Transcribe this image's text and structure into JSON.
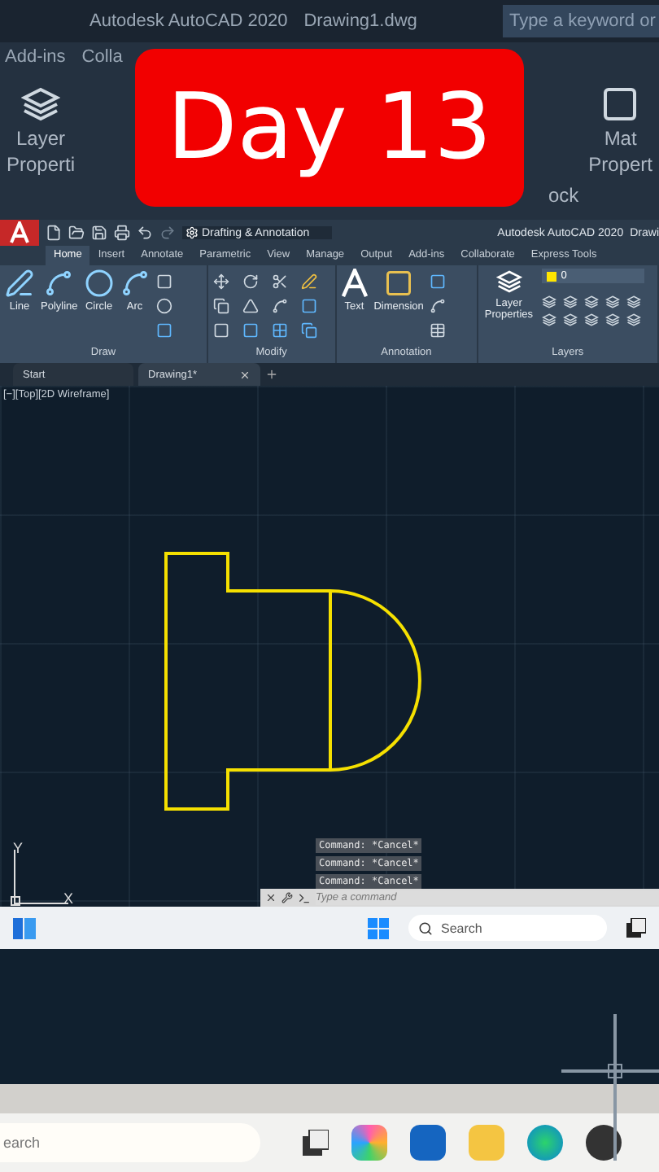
{
  "background_window": {
    "title": "Autodesk AutoCAD 2020",
    "file": "Drawing1.dwg",
    "search": {
      "placeholder": "Type a keyword or"
    },
    "menu": [
      "Add-ins",
      "Colla"
    ],
    "left_labels": [
      "Layer",
      "Properti"
    ],
    "right_labels": [
      "Mat",
      "Propert"
    ],
    "group_label": "ock"
  },
  "overlay_badge": "Day 13",
  "quick_access": {
    "workspace": "Drafting & Annotation",
    "title": "Autodesk AutoCAD 2020",
    "file": "Drawi"
  },
  "ribbon_tabs": [
    {
      "label": "Home",
      "selected": true
    },
    {
      "label": "Insert",
      "selected": false
    },
    {
      "label": "Annotate",
      "selected": false
    },
    {
      "label": "Parametric",
      "selected": false
    },
    {
      "label": "View",
      "selected": false
    },
    {
      "label": "Manage",
      "selected": false
    },
    {
      "label": "Output",
      "selected": false
    },
    {
      "label": "Add-ins",
      "selected": false
    },
    {
      "label": "Collaborate",
      "selected": false
    },
    {
      "label": "Express Tools",
      "selected": false
    }
  ],
  "panels": {
    "draw": {
      "title": "Draw",
      "tools": [
        "Line",
        "Polyline",
        "Circle",
        "Arc"
      ]
    },
    "modify": {
      "title": "Modify"
    },
    "annotation": {
      "title": "Annotation",
      "tools": [
        "Text",
        "Dimension"
      ]
    },
    "layers": {
      "title": "Layers",
      "tool": "Layer Properties",
      "current_layer": "0"
    }
  },
  "file_tabs": [
    {
      "label": "Start",
      "selected": false,
      "closable": false
    },
    {
      "label": "Drawing1*",
      "selected": true,
      "closable": true
    }
  ],
  "viewport_label": "[−][Top][2D Wireframe]",
  "ucs": {
    "y": "Y",
    "x": "X"
  },
  "command_history": [
    "Command: *Cancel*",
    "Command: *Cancel*",
    "Command: *Cancel*"
  ],
  "command_line": {
    "placeholder": "Type a command"
  },
  "taskbar": {
    "search": {
      "placeholder": "Search"
    }
  },
  "bottom_taskbar": {
    "search": {
      "value": "earch"
    }
  }
}
